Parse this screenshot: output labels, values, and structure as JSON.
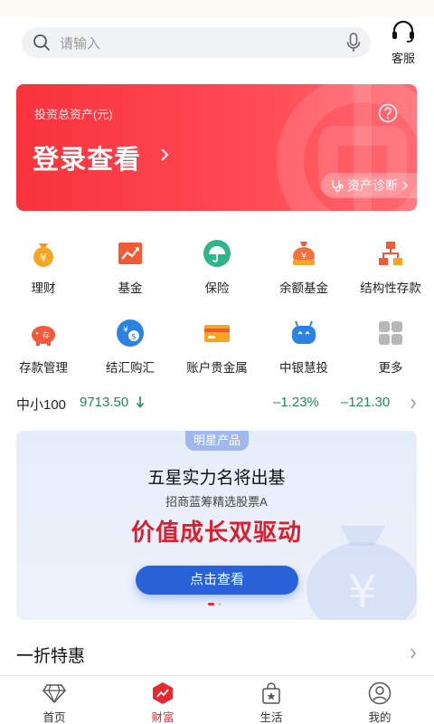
{
  "search": {
    "placeholder": "请输入"
  },
  "service": {
    "label": "客服"
  },
  "asset_card": {
    "subtitle": "投资总资产(元)",
    "login_label": "登录查看",
    "diagnosis_label": "资产诊断"
  },
  "grid": {
    "row1": [
      {
        "label": "理财",
        "icon": "money-bag-icon"
      },
      {
        "label": "基金",
        "icon": "trend-chart-icon"
      },
      {
        "label": "保险",
        "icon": "umbrella-icon"
      },
      {
        "label": "余额基金",
        "icon": "coin-bag-icon"
      },
      {
        "label": "结构性存款",
        "icon": "structure-icon"
      }
    ],
    "row2": [
      {
        "label": "存款管理",
        "icon": "piggy-bank-icon"
      },
      {
        "label": "结汇购汇",
        "icon": "currency-exchange-icon"
      },
      {
        "label": "账户贵金属",
        "icon": "gold-bar-icon"
      },
      {
        "label": "中银慧投",
        "icon": "robot-icon"
      },
      {
        "label": "更多",
        "icon": "more-grid-icon"
      }
    ]
  },
  "ticker": {
    "name": "中小100",
    "value": "9713.50",
    "change_pct": "–1.23%",
    "change": "–121.30",
    "color": "#1f8a5a"
  },
  "banner": {
    "tag": "明星产品",
    "title": "五星实力名将出基",
    "subtitle": "招商蓝筹精选股票A",
    "headline": "价值成长双驱动",
    "cta": "点击查看"
  },
  "section": {
    "title": "一折特惠"
  },
  "tabbar": [
    {
      "label": "首页",
      "icon": "diamond-icon",
      "active": false
    },
    {
      "label": "财富",
      "icon": "wealth-icon",
      "active": true
    },
    {
      "label": "生活",
      "icon": "shopping-bag-icon",
      "active": false
    },
    {
      "label": "我的",
      "icon": "user-icon",
      "active": false
    }
  ],
  "colors": {
    "brand_red": "#f7333c",
    "accent_blue": "#2962d8",
    "active_tab": "#e62a30"
  }
}
